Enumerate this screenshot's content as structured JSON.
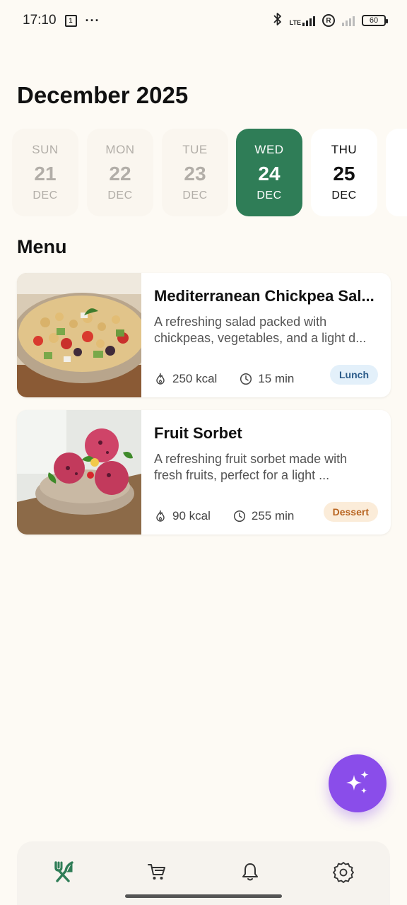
{
  "status_bar": {
    "time": "17:10",
    "calendar_day": "1",
    "lte": "LTE",
    "registered": "R",
    "battery": "60"
  },
  "header": {
    "month": "December 2025"
  },
  "days": [
    {
      "dow": "SUN",
      "num": "21",
      "mon": "DEC",
      "state": "past"
    },
    {
      "dow": "MON",
      "num": "22",
      "mon": "DEC",
      "state": "past"
    },
    {
      "dow": "TUE",
      "num": "23",
      "mon": "DEC",
      "state": "past"
    },
    {
      "dow": "WED",
      "num": "24",
      "mon": "DEC",
      "state": "selected"
    },
    {
      "dow": "THU",
      "num": "25",
      "mon": "DEC",
      "state": "future"
    }
  ],
  "menu": {
    "title": "Menu",
    "items": [
      {
        "name": "Mediterranean Chickpea Sal...",
        "description": "A refreshing salad packed with chickpeas, vegetables, and a light d...",
        "kcal": "250 kcal",
        "time": "15 min",
        "tag": "Lunch"
      },
      {
        "name": "Fruit Sorbet",
        "description": "A refreshing fruit sorbet made with fresh fruits, perfect for a light ...",
        "kcal": "90 kcal",
        "time": "255 min",
        "tag": "Dessert"
      }
    ]
  },
  "fab": {
    "icon": "sparkles-icon"
  },
  "nav": {
    "items": [
      {
        "icon": "fork-knife-icon",
        "active": true
      },
      {
        "icon": "cart-icon",
        "active": false
      },
      {
        "icon": "bell-icon",
        "active": false
      },
      {
        "icon": "gear-icon",
        "active": false
      }
    ]
  },
  "colors": {
    "accent": "#2f7d57",
    "fab": "#8a4dea",
    "background": "#fdfaf4"
  }
}
